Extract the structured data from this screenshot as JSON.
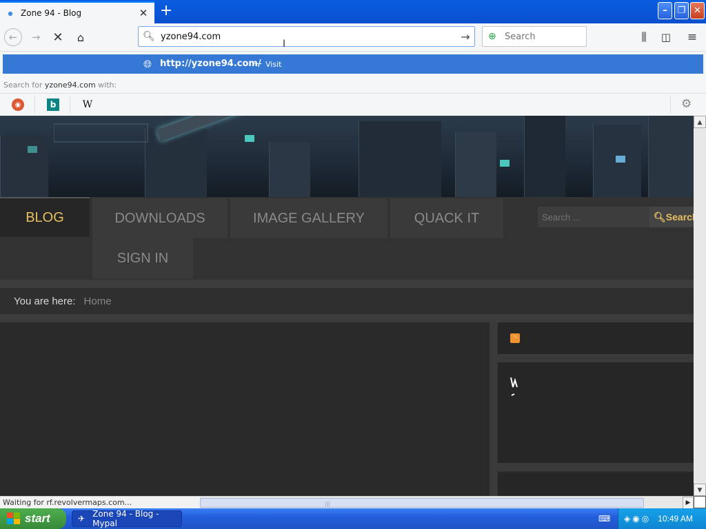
{
  "browser": {
    "tab_title": "Zone 94 - Blog",
    "url_value": "yzone94.com",
    "search_placeholder": "Search",
    "suggestion": {
      "url": "http://yzone94.com/",
      "separator": "—",
      "action": "Visit"
    },
    "search_for": {
      "prefix": "Search for",
      "term": "yzone94.com",
      "suffix": "with:"
    },
    "engines": [
      "duckduckgo-icon",
      "bing-icon",
      "wikipedia-icon"
    ],
    "wiki_glyph": "W",
    "bing_glyph": "b"
  },
  "site": {
    "menu": {
      "blog": "BLOG",
      "downloads": "DOWNLOADS",
      "gallery": "IMAGE GALLERY",
      "quack": "QUACK IT",
      "signin": "SIGN IN"
    },
    "search": {
      "placeholder": "Search ...",
      "button": "Search"
    },
    "breadcrumb": {
      "label": "You are here:",
      "home": "Home"
    },
    "accent_color": "#e8c061"
  },
  "status": {
    "text": "Waiting for rf.revolvermaps.com..."
  },
  "taskbar": {
    "start_label": "start",
    "window_label": "Zone 94 - Blog - Mypal",
    "clock": "10:49 AM"
  }
}
